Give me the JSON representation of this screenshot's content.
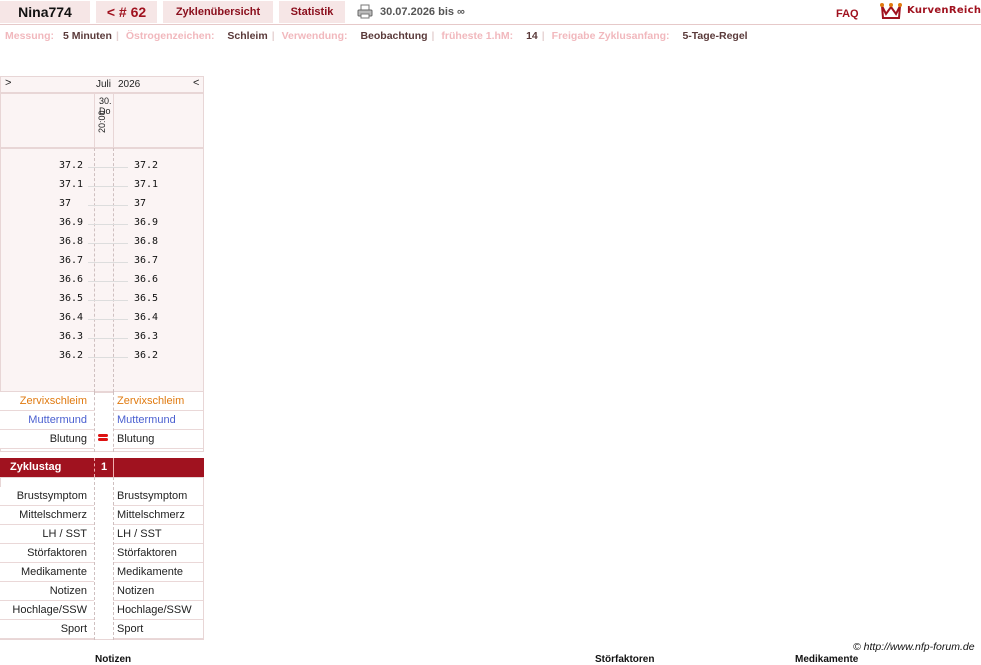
{
  "header": {
    "user": "Nina774",
    "cycle": "< # 62",
    "tab_overview": "Zyklenübersicht",
    "tab_stats": "Statistik",
    "date_range": "30.07.2026 bis ∞",
    "faq": "FAQ",
    "brand": "KurvenReich"
  },
  "settings": [
    {
      "label": "Messung:",
      "value": "5 Minuten"
    },
    {
      "label": "Östrogenzeichen:",
      "value": "Schleim"
    },
    {
      "label": "Verwendung:",
      "value": "Beobachtung"
    },
    {
      "label": "früheste 1.hM:",
      "value": "14"
    },
    {
      "label": "Freigabe Zyklusanfang:",
      "value": "5-Tage-Regel"
    }
  ],
  "chart": {
    "nav_next": ">",
    "nav_prev": "<",
    "month": "Juli",
    "year": "2026",
    "day_num": "30.",
    "day_name": "Do",
    "day_time": "20:00",
    "temps": [
      "37.2",
      "37.1",
      "37",
      "36.9",
      "36.8",
      "36.7",
      "36.6",
      "36.5",
      "36.4",
      "36.3",
      "36.2"
    ],
    "cervix": "Zervixschleim",
    "mumu": "Muttermund",
    "bleeding": "Blutung",
    "cycle_day_label": "Zyklustag",
    "cycle_day_value": "1",
    "extra_rows": [
      "Brustsymptom",
      "Mittelschmerz",
      "LH / SST",
      "Störfaktoren",
      "Medikamente",
      "Notizen",
      "Hochlage/SSW",
      "Sport"
    ]
  },
  "footer": {
    "copyright": "© http://www.nfp-forum.de",
    "bottom_notes": "Notizen",
    "bottom_stoer": "Störfaktoren",
    "bottom_medi": "Medikamente"
  },
  "colors": {
    "accent": "#a0121f",
    "tab_bg": "#f6e6e6",
    "label_pink": "#f1b8bd"
  }
}
